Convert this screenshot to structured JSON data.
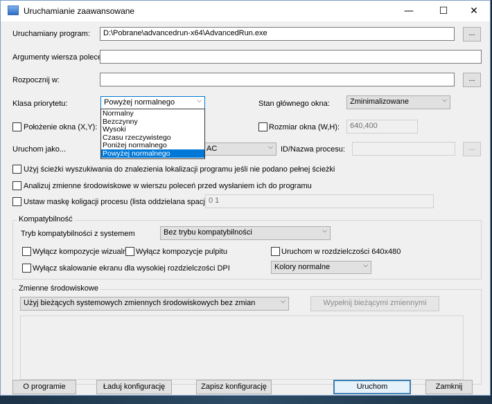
{
  "window": {
    "title": "Uruchamianie zaawansowane",
    "controls": {
      "minimize": "—",
      "maximize": "☐",
      "close": "✕"
    }
  },
  "program": {
    "label": "Uruchamiany program:",
    "value": "D:\\Pobrane\\advancedrun-x64\\AdvancedRun.exe",
    "browse": "..."
  },
  "arguments": {
    "label": "Argumenty wiersza poleceń:",
    "value": ""
  },
  "start_in": {
    "label": "Rozpocznij w:",
    "value": "",
    "browse": "..."
  },
  "priority": {
    "label": "Klasa priorytetu:",
    "selected": "Powyżej normalnego",
    "options": [
      "Normalny",
      "Bezczynny",
      "Wysoki",
      "Czasu rzeczywistego",
      "Poniżej normalnego",
      "Powyżej normalnego"
    ]
  },
  "main_window_state": {
    "label": "Stan głównego okna:",
    "selected": "Zminimalizowane"
  },
  "window_position": {
    "label": "Położenie okna (X,Y):"
  },
  "window_size": {
    "label": "Rozmiar okna (W,H):",
    "value": "640,400"
  },
  "run_as": {
    "label": "Uruchom jako...",
    "selected_suffix": "AC"
  },
  "process_id": {
    "label": "ID/Nazwa procesu:",
    "value": "",
    "browse": "..."
  },
  "options": {
    "search_path": "Użyj ścieżki wyszukiwania do znalezienia lokalizacji programu jeśli nie podano pełnej ścieżki",
    "parse_env": "Analizuj zmienne środowiskowe w wierszu poleceń przed wysłaniem ich do programu",
    "affinity_label": "Ustaw maskę koligacji procesu (lista oddzielana spacjami):",
    "affinity_value": "0 1"
  },
  "compatibility": {
    "group_title": "Kompatybilność",
    "mode_label": "Tryb kompatybilności z systemem",
    "mode_selected": "Bez trybu kompatybilności",
    "disable_visual": "Wyłącz kompozycje wizualne",
    "disable_desktop": "Wyłącz kompozycje pulpitu",
    "run_640": "Uruchom w rozdzielczości 640x480",
    "disable_dpi": "Wyłącz skalowanie ekranu dla wysokiej rozdzielczości DPI",
    "colors_selected": "Kolory normalne"
  },
  "environment": {
    "group_title": "Zmienne środowiskowe",
    "mode_selected": "Użyj bieżących systemowych zmiennych środowiskowych bez zmian",
    "fill_button": "Wypełnij bieżącymi zmiennymi"
  },
  "footer": {
    "about": "O programie",
    "load": "Ładuj konfigurację",
    "save": "Zapisz konfigurację",
    "run": "Uruchom",
    "close": "Zamknij"
  }
}
